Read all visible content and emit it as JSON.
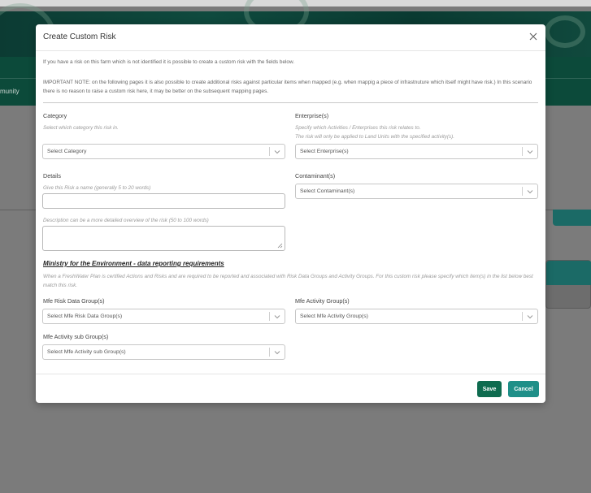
{
  "background": {
    "nav_partial_label": "munity"
  },
  "modal": {
    "title": "Create Custom Risk",
    "intro": "If you have a risk on this farm which is not identified it is possible to create a custom risk with the fields below.",
    "note": "IMPORTANT NOTE: on the following pages it is also possible to create additional risks against particular items when mapped (e.g. when mappig a piece of infrastnuture which itself might have risk.) In this scenario there is no reason to raise a custom risk here, it may be better on the subsequent mapping pages.",
    "category": {
      "label": "Category",
      "help": "Select which category this risk in.",
      "placeholder": "Select Category"
    },
    "enterprise": {
      "label": "Enterprise(s)",
      "help_line1": "Specify which Activities / Enterprises this risk relates to.",
      "help_line2": "The risk will only be applied to Land Units with the specified activity(s).",
      "placeholder": "Select Enterprise(s)"
    },
    "details": {
      "label": "Details",
      "name_help": "Give this Risk a name (generally 5 to 20 words)",
      "name_value": "",
      "description_help": "Description can be a more detailed overview of the risk (50 to 100 words)",
      "description_value": ""
    },
    "contaminant": {
      "label": "Contaminant(s)",
      "placeholder": "Select Contaminant(s)"
    },
    "mfe": {
      "section_title": "Ministry for the Environment - data reporting requirements",
      "section_help": "When a FreshWater Plan is certified Actions and Risks and are required to be reported and associated with Risk Data Groups and Activity Groups. For this custom risk please specify which item(s) in the list below best match this risk.",
      "risk_data_group_label": "Mfe Risk Data Group(s)",
      "risk_data_group_placeholder": "Select Mfe Risk Data Group(s)",
      "activity_group_label": "Mfe Activity Group(s)",
      "activity_group_placeholder": "Select Mfe Activity Group(s)",
      "activity_sub_group_label": "Mfe Activity sub Group(s)",
      "activity_sub_group_placeholder": "Select Mfe Activity sub Group(s)"
    },
    "buttons": {
      "save": "Save",
      "cancel": "Cancel"
    }
  },
  "colors": {
    "save_button": "#0e6b4f",
    "cancel_button": "#1f8f88",
    "overlay": "#7a7a7a"
  },
  "icons": {
    "close": "close-icon",
    "dropdown": "chevron-down-icon",
    "resize": "resize-grip-icon"
  }
}
